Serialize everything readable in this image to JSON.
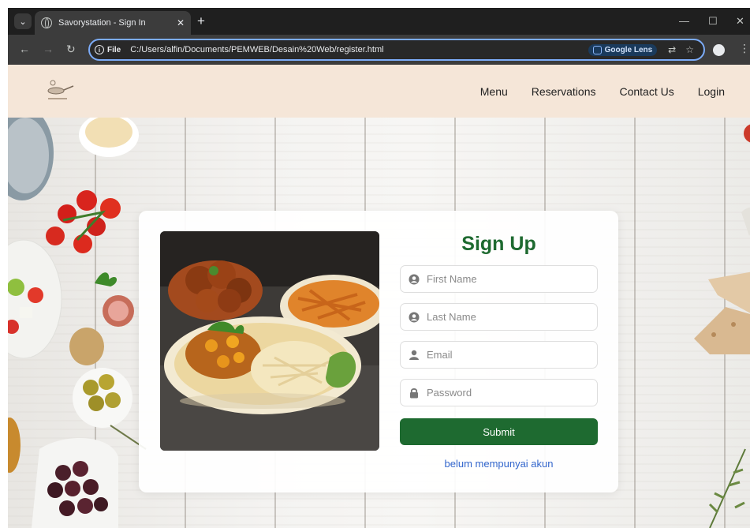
{
  "browser": {
    "tab_title": "Savorystation - Sign In",
    "tab_close": "✕",
    "new_tab": "+",
    "info_label": "File",
    "url": "C:/Users/alfin/Documents/PEMWEB/Desain%20Web/register.html",
    "lens_label": "Google Lens",
    "window_controls": [
      "—",
      "☐",
      "✕"
    ]
  },
  "site": {
    "nav": {
      "items": [
        {
          "label": "Menu"
        },
        {
          "label": "Reservations"
        },
        {
          "label": "Contact Us"
        },
        {
          "label": "Login"
        }
      ]
    }
  },
  "form": {
    "title": "Sign Up",
    "fields": [
      {
        "placeholder": "First Name",
        "icon": "user-circle-icon"
      },
      {
        "placeholder": "Last Name",
        "icon": "user-circle-icon"
      },
      {
        "placeholder": "Email",
        "icon": "user-icon"
      },
      {
        "placeholder": "Password",
        "icon": "lock-icon"
      }
    ],
    "submit_label": "Submit",
    "alt_link": "belum mempunyai akun"
  },
  "colors": {
    "brand_green": "#1e6a30",
    "nav_bg": "#f5e6d8",
    "link_blue": "#3366cc"
  }
}
